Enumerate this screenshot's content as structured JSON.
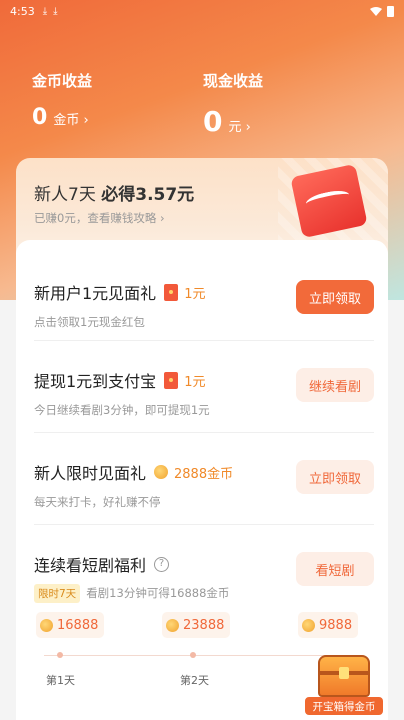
{
  "status_bar": {
    "time": "4:53",
    "download_1": "⤓",
    "download_2": "⤓"
  },
  "earnings": {
    "coin_title": "金币收益",
    "coin_value": "0",
    "coin_unit": "金币 ›",
    "cash_title": "现金收益",
    "cash_value": "0",
    "cash_unit": "元 ›"
  },
  "banner": {
    "title_prefix": "新人7天 ",
    "title_bold": "必得3.57元",
    "subtitle": "已赚0元，查看赚钱攻略 ›"
  },
  "tasks": [
    {
      "title": "新用户1元见面礼",
      "reward": "1元",
      "subtitle": "点击领取1元现金红包",
      "button": "立即领取"
    },
    {
      "title": "提现1元到支付宝",
      "reward": "1元",
      "subtitle": "今日继续看剧3分钟，即可提现1元",
      "button": "继续看剧"
    },
    {
      "title": "新人限时见面礼",
      "reward": "2888金币",
      "subtitle": "每天来打卡，好礼赚不停",
      "button": "立即领取"
    },
    {
      "title": "连续看短剧福利",
      "tag": "限时7天",
      "subtitle": "看剧13分钟可得16888金币",
      "button": "看短剧",
      "help_icon": "?"
    }
  ],
  "streak": {
    "coins": [
      "16888",
      "23888",
      "9888"
    ],
    "days": [
      "第1天",
      "第2天"
    ],
    "chest_label": "开宝箱得金币"
  }
}
